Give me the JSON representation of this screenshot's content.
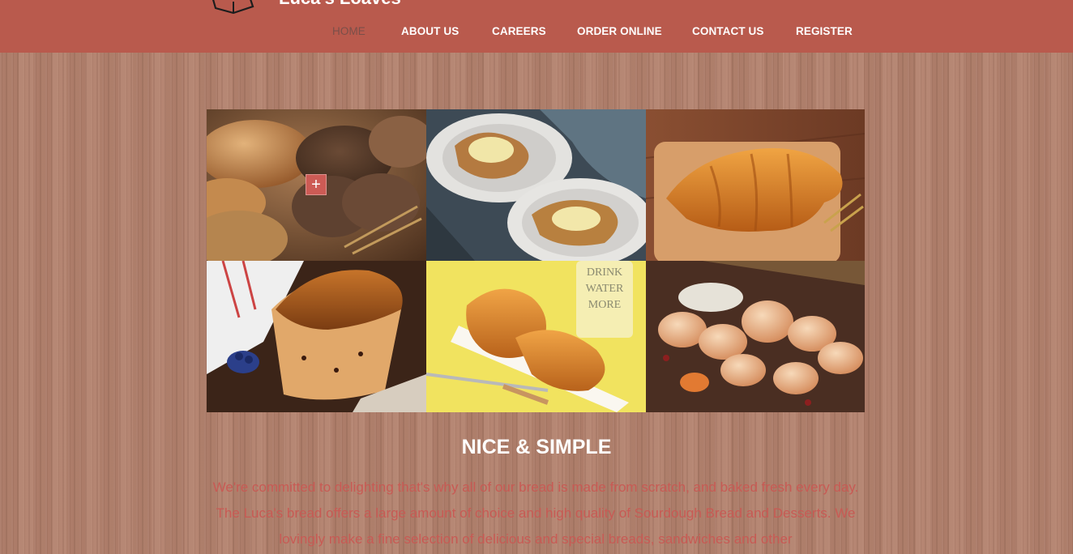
{
  "brand": {
    "name": "Luca's Loaves",
    "logo": "bread-box-icon"
  },
  "nav": {
    "items": [
      {
        "label": "HOME",
        "active": true
      },
      {
        "label": "ABOUT US",
        "active": false
      },
      {
        "label": "CAREERS",
        "active": false
      },
      {
        "label": "ORDER ONLINE",
        "active": false
      },
      {
        "label": "CONTACT US",
        "active": false
      },
      {
        "label": "REGISTER",
        "active": false
      }
    ]
  },
  "gallery": {
    "tiles": [
      {
        "subject": "assorted breads",
        "icon": "plus-icon"
      },
      {
        "subject": "danish pastries"
      },
      {
        "subject": "croissant on board"
      },
      {
        "subject": "raisin loaf"
      },
      {
        "subject": "croissants on plate",
        "cup_text": "DRINK WATER MORE"
      },
      {
        "subject": "bread rolls"
      }
    ],
    "zoom_symbol": "+"
  },
  "section": {
    "title": "NICE & SIMPLE",
    "text": "We're committed to delighting that's why all of our bread is made from scratch, and baked fresh every day. The Luca's bread offers a large amount of choice and high quality of Sourdough Bread and Desserts. We lovingly make a fine selection of delicious and special breads, sandwiches and other"
  },
  "colors": {
    "header": "#b95a4d",
    "accent": "#cd5b55",
    "active_nav": "#7a4f49",
    "body_text": "#c85a54",
    "background": "#b07e6a"
  }
}
